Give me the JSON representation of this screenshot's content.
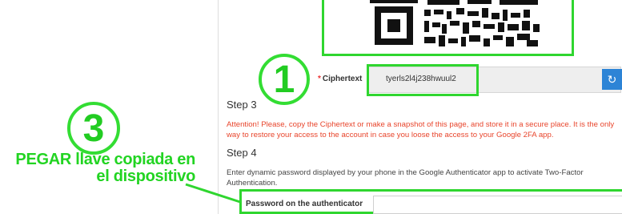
{
  "annotations": {
    "circle_1": "1",
    "circle_3": "3",
    "callout_line1": "PEGAR llave copiada en",
    "callout_line2": "el dispositivo"
  },
  "ciphertext": {
    "label": "Ciphertext",
    "required_mark": "*",
    "value": "tyerls2l4j238hwuul2",
    "refresh_icon": "refresh-icon"
  },
  "step3": {
    "title": "Step 3",
    "warning_line1": "Attention! Please, copy the Ciphertext or make a snapshot of this page, and store it in a secure place. It is the only",
    "warning_line2": "way to restore your access to the account in case you loose the access to your Google 2FA app."
  },
  "step4": {
    "title": "Step 4",
    "instructions_line1": "Enter dynamic password displayed by your phone in the Google Authenticator app to activate Two-Factor",
    "instructions_line2": "Authentication.",
    "password_label": "Password on the authenticator",
    "password_value": ""
  },
  "colors": {
    "highlight": "#2fd62f",
    "warning": "#e8452c",
    "button": "#2d84d6"
  }
}
